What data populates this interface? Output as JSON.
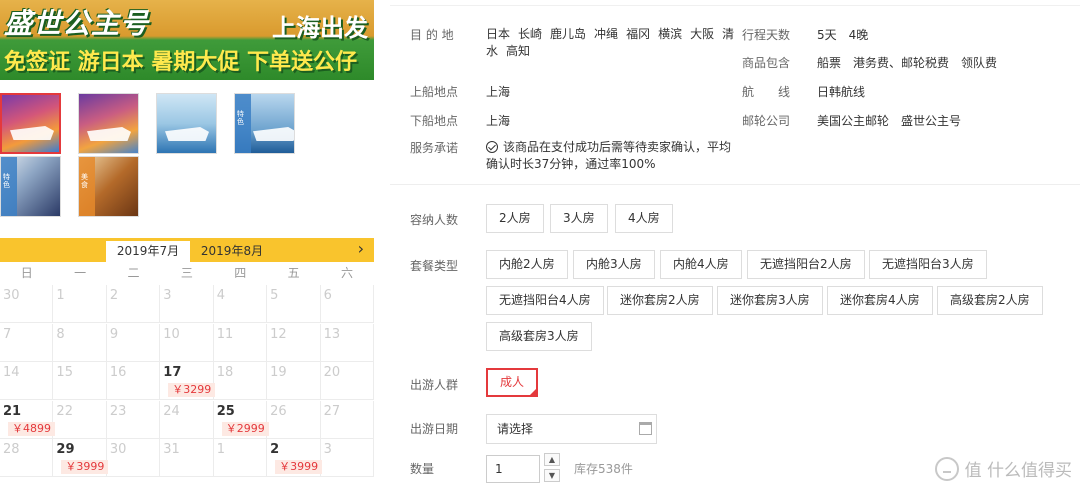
{
  "banner": {
    "title": "盛世公主号",
    "departure": "上海出发",
    "promo": "免签证 游日本 暑期大促 下单送公仔"
  },
  "thumbnails": [
    {
      "name": "thumb-ship-sunset",
      "selected": true,
      "caption": ""
    },
    {
      "name": "thumb-ship-sunset-2",
      "selected": false,
      "caption": ""
    },
    {
      "name": "thumb-ship-wave",
      "selected": false,
      "caption": ""
    },
    {
      "name": "thumb-ship-sea",
      "selected": false,
      "caption": "特色"
    },
    {
      "name": "thumb-interior",
      "selected": false,
      "caption": "特色"
    },
    {
      "name": "thumb-food",
      "selected": false,
      "caption": "美食"
    }
  ],
  "calendar": {
    "active_month": "2019年7月",
    "next_month": "2019年8月",
    "next_arrow": "›",
    "weekdays": [
      "日",
      "一",
      "二",
      "三",
      "四",
      "五",
      "六"
    ],
    "rows": [
      [
        {
          "d": "30"
        },
        {
          "d": "1"
        },
        {
          "d": "2"
        },
        {
          "d": "3"
        },
        {
          "d": "4"
        },
        {
          "d": "5"
        },
        {
          "d": "6"
        }
      ],
      [
        {
          "d": "7"
        },
        {
          "d": "8"
        },
        {
          "d": "9"
        },
        {
          "d": "10"
        },
        {
          "d": "11"
        },
        {
          "d": "12"
        },
        {
          "d": "13"
        }
      ],
      [
        {
          "d": "14"
        },
        {
          "d": "15"
        },
        {
          "d": "16"
        },
        {
          "d": "17",
          "on": true,
          "price": "￥3299"
        },
        {
          "d": "18"
        },
        {
          "d": "19"
        },
        {
          "d": "20"
        }
      ],
      [
        {
          "d": "21",
          "on": true,
          "price": "￥4899"
        },
        {
          "d": "22"
        },
        {
          "d": "23"
        },
        {
          "d": "24"
        },
        {
          "d": "25",
          "on": true,
          "price": "￥2999"
        },
        {
          "d": "26"
        },
        {
          "d": "27"
        }
      ],
      [
        {
          "d": "28"
        },
        {
          "d": "29",
          "on": true,
          "price": "￥3999"
        },
        {
          "d": "30"
        },
        {
          "d": "31"
        },
        {
          "d": "1"
        },
        {
          "d": "2",
          "on": true,
          "price": "￥3999"
        },
        {
          "d": "3"
        }
      ]
    ]
  },
  "info": {
    "dest_label": "目 的 地",
    "destinations": [
      "日本",
      "长崎",
      "鹿儿岛",
      "冲绳",
      "福冈",
      "横滨",
      "大阪",
      "清水",
      "高知"
    ],
    "days_label": "行程天数",
    "days_value": "5天　4晚",
    "includes_label": "商品包含",
    "includes_value": "船票　港务费、邮轮税费　领队费",
    "board_label": "上船地点",
    "board_value": "上海",
    "route_label": "航　　线",
    "route_value": "日韩航线",
    "alight_label": "下船地点",
    "alight_value": "上海",
    "company_label": "邮轮公司",
    "company_value": "美国公主邮轮　盛世公主号",
    "promise_label": "服务承诺",
    "promise_value": "该商品在支付成功后需等待卖家确认，平均确认时长37分钟，通过率100%"
  },
  "options": {
    "capacity_label": "容纳人数",
    "capacity": [
      "2人房",
      "3人房",
      "4人房"
    ],
    "package_label": "套餐类型",
    "packages": [
      "内舱2人房",
      "内舱3人房",
      "内舱4人房",
      "无遮挡阳台2人房",
      "无遮挡阳台3人房",
      "无遮挡阳台4人房",
      "迷你套房2人房",
      "迷你套房3人房",
      "迷你套房4人房",
      "高级套房2人房",
      "高级套房3人房"
    ],
    "group_label": "出游人群",
    "group": [
      "成人"
    ],
    "date_label": "出游日期",
    "date_placeholder": "请选择",
    "qty_label": "数量",
    "qty_value": "1",
    "qty_up": "▲",
    "qty_down": "▼",
    "stock": "库存538件"
  },
  "watermark": "值 什么值得买"
}
